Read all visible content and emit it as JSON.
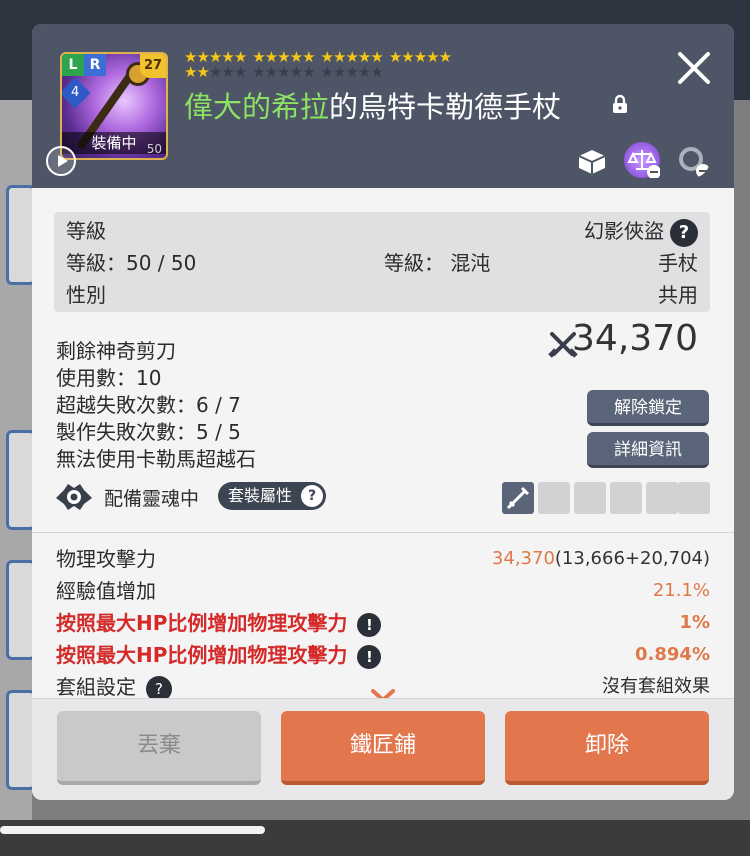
{
  "item": {
    "badge_l": "L",
    "badge_r": "R",
    "level_badge": "27",
    "star_badge": "4",
    "equipped_label": "裝備中",
    "icon_level": "50",
    "name_highlight": "偉大的希拉",
    "name_rest": "的烏特卡勒德手杖",
    "stars_on": 22,
    "stars_total": 35
  },
  "info": {
    "row1_left": "等級",
    "row1_right": "幻影俠盜",
    "row2_left": "等級：50 / 50",
    "row2_mid": "等級： 混沌",
    "row2_right": "手杖",
    "row3_left": "性別",
    "row3_right": "共用"
  },
  "details": {
    "line1": "剩餘神奇剪刀",
    "line2": "使用數：10",
    "line3": "超越失敗次數：6 / 7",
    "line4": "製作失敗次數：5 / 5",
    "line5": "無法使用卡勒馬超越石",
    "power": "34,370",
    "unlock_button": "解除鎖定",
    "detail_button": "詳細資訊"
  },
  "soul": {
    "label": "配備靈魂中",
    "set_button": "套裝屬性"
  },
  "stats": {
    "atk_label": "物理攻擊力",
    "atk_value": "34,370",
    "atk_breakdown": "(13,666+20,704)",
    "exp_label": "經驗值增加",
    "exp_value": "21.1%",
    "hp1_label": "按照最大HP比例增加物理攻擊力",
    "hp1_value": "1%",
    "hp2_label": "按照最大HP比例增加物理攻擊力",
    "hp2_value": "0.894%",
    "set_label": "套組設定",
    "set_value": "沒有套組效果"
  },
  "footer": {
    "discard": "丟棄",
    "smithy": "鐵匠鋪",
    "unequip": "卸除"
  },
  "colors": {
    "header_bg": "#4e5566",
    "accent_orange": "#e2774d",
    "name_green": "#8be264",
    "red_stat": "#d42a2a"
  }
}
